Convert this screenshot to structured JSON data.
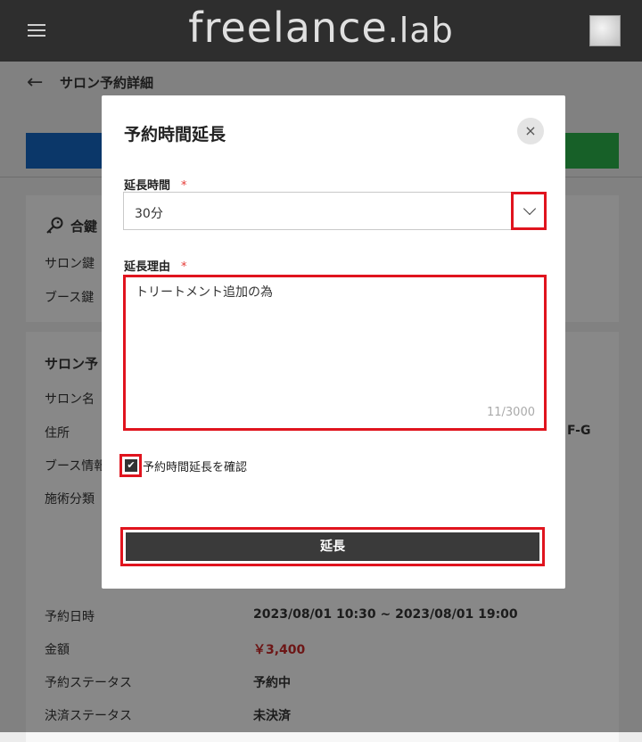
{
  "header": {
    "logo_main": "freelance",
    "logo_sub": ".lab"
  },
  "page": {
    "title": "サロン予約詳細"
  },
  "background": {
    "key_section_title": "合鍵",
    "salon_key_label": "サロン鍵",
    "booth_key_label": "ブース鍵",
    "salon_section_title": "サロン予",
    "salon_name_label": "サロン名",
    "address_label": "住所",
    "address_partial": "F-G",
    "booth_info_label": "ブース情報",
    "treatment_label": "施術分類",
    "reservation_datetime_label": "予約日時",
    "reservation_datetime_value": "2023/08/01 10:30 ~ 2023/08/01 19:00",
    "amount_label": "金額",
    "amount_value": "￥3,400",
    "reservation_status_label": "予約ステータス",
    "reservation_status_value": "予約中",
    "payment_status_label": "決済ステータス",
    "payment_status_value": "未決済"
  },
  "modal": {
    "title": "予約時間延長",
    "close_icon": "×",
    "duration_label": "延長時間",
    "required_mark": "*",
    "duration_value": "30分",
    "reason_label": "延長理由",
    "reason_value": "トリートメント追加の為",
    "char_count": "11/3000",
    "confirm_label": "予約時間延長を確認",
    "confirm_checked": true,
    "submit_label": "延長"
  },
  "colors": {
    "header_bg": "#2e2e2e",
    "highlight": "#e0141e",
    "primary_button": "#3a3a3a",
    "price": "#c62828"
  }
}
